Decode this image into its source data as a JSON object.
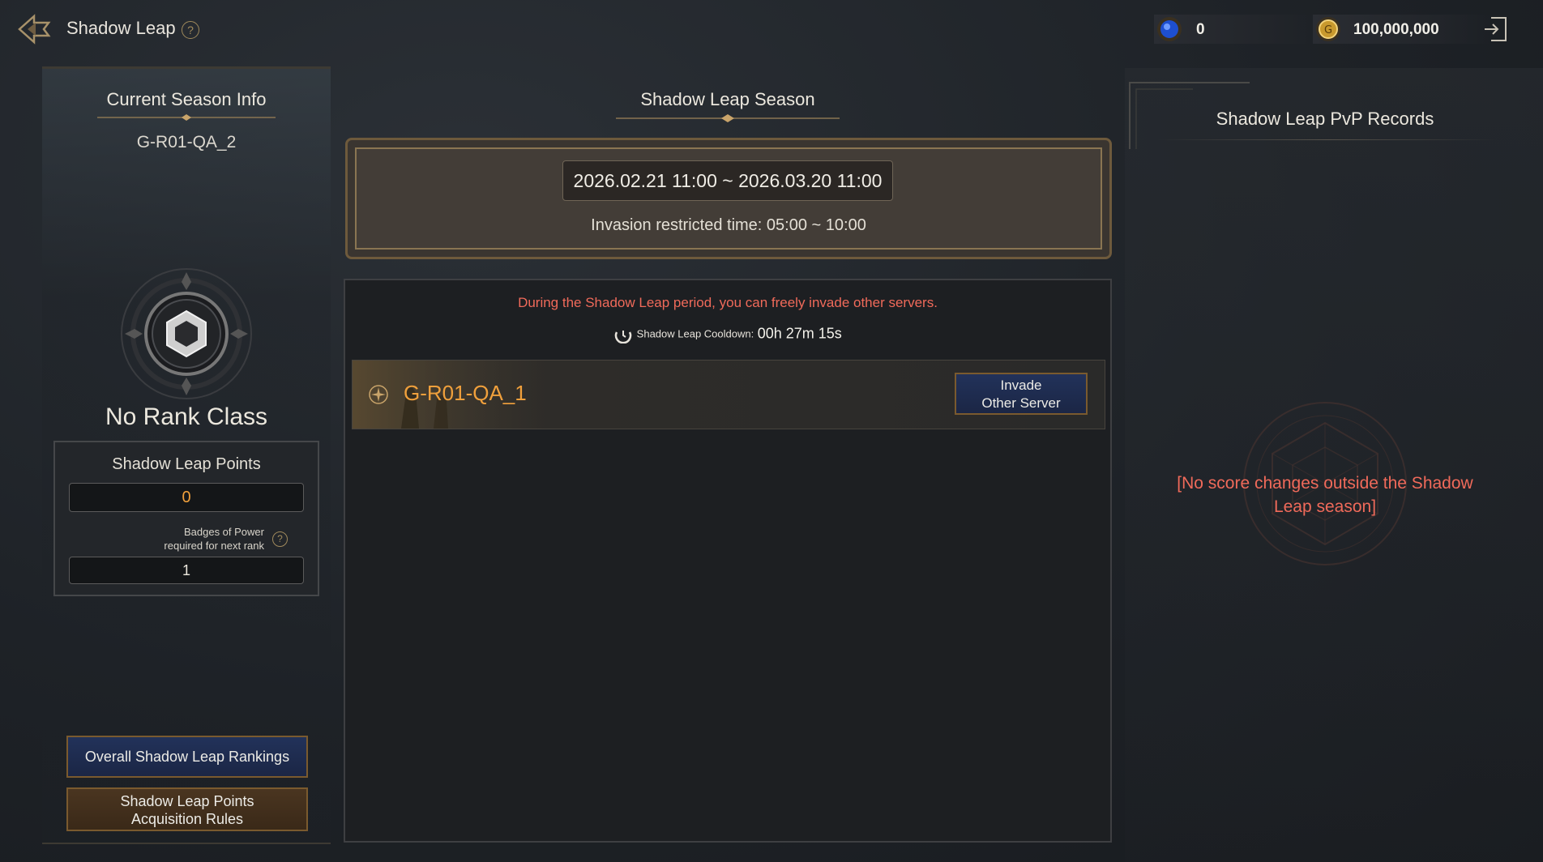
{
  "header": {
    "title": "Shadow Leap",
    "help_glyph": "?",
    "currencies": [
      {
        "icon": "blue-gem-icon",
        "value": "0"
      },
      {
        "icon": "gold-coin-icon",
        "value": "100,000,000"
      }
    ]
  },
  "left": {
    "season_info_heading": "Current Season Info",
    "season_name": "G-R01-QA_2",
    "rank_class": "No Rank Class",
    "points_heading": "Shadow Leap Points",
    "points_value": "0",
    "badges_label_line1": "Badges of Power",
    "badges_label_line2": "required for next rank",
    "next_rank_value": "1",
    "rankings_button": "Overall Shadow Leap Rankings",
    "rules_button_line1": "Shadow Leap Points",
    "rules_button_line2": "Acquisition Rules"
  },
  "center": {
    "season_heading": "Shadow Leap Season",
    "date_range": "2026.02.21 11:00 ~ 2026.03.20 11:00",
    "restricted_time": "Invasion restricted time: 05:00 ~ 10:00",
    "notice": "During the Shadow Leap period, you can freely invade other servers.",
    "cooldown_label": "Shadow Leap Cooldown:",
    "cooldown_time": "00h 27m 15s",
    "servers": [
      {
        "name": "G-R01-QA_1",
        "button_line1": "Invade",
        "button_line2": "Other Server"
      }
    ]
  },
  "right": {
    "pvp_heading": "Shadow Leap PvP Records",
    "no_score_line1": "[No score changes outside the Shadow",
    "no_score_line2": "Leap season]"
  },
  "colors": {
    "accent_orange": "#f0a03c",
    "notice_red": "#f06a5a",
    "button_blue": "#22325a",
    "button_brown": "#4a3520",
    "frame_gold": "#7a5a2e"
  }
}
